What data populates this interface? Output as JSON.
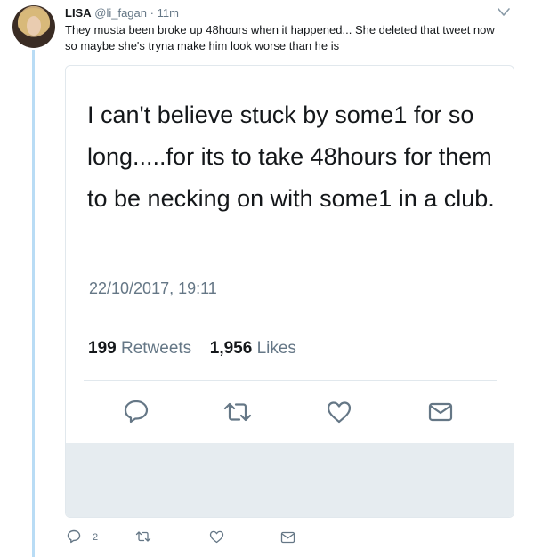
{
  "tweet": {
    "name": "LISA",
    "handle": "@li_fagan",
    "dot": "·",
    "time": "11m",
    "text": "They musta been broke up 48hours when it happened... She deleted that tweet now so maybe she's tryna make him look worse than he is"
  },
  "quoted": {
    "text": "I can't believe stuck by some1 for so long.....for its to take 48hours for them to be necking on with some1 in a club.",
    "date": "22/10/2017, 19:11",
    "retweets_count": "199",
    "retweets_label": "Retweets",
    "likes_count": "1,956",
    "likes_label": "Likes"
  },
  "actions": {
    "reply_count": "2"
  },
  "icons": {
    "reply": "reply-icon",
    "retweet": "retweet-icon",
    "like": "heart-icon",
    "dm": "envelope-icon",
    "more": "chevron-down-icon"
  },
  "colors": {
    "thread_line": "#b9dcf5",
    "icon_gray": "#657786",
    "card_border": "#e1e8ed",
    "card_footer": "#e6ecf0"
  }
}
